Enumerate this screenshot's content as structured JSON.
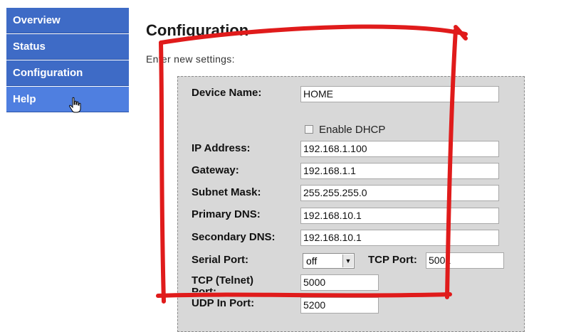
{
  "nav": {
    "items": [
      {
        "label": "Overview"
      },
      {
        "label": "Status"
      },
      {
        "label": "Configuration"
      },
      {
        "label": "Help"
      }
    ]
  },
  "page": {
    "title": "Configuration",
    "intro": "Enter new settings:"
  },
  "form": {
    "device_name": {
      "label": "Device Name:",
      "value": "HOME"
    },
    "dhcp": {
      "label": "Enable DHCP",
      "checked": false
    },
    "ip_address": {
      "label": "IP Address:",
      "value": "192.168.1.100"
    },
    "gateway": {
      "label": "Gateway:",
      "value": "192.168.1.1"
    },
    "subnet_mask": {
      "label": "Subnet Mask:",
      "value": "255.255.255.0"
    },
    "primary_dns": {
      "label": "Primary DNS:",
      "value": "192.168.10.1"
    },
    "secondary_dns": {
      "label": "Secondary DNS:",
      "value": "192.168.10.1"
    },
    "serial_port": {
      "label": "Serial Port:",
      "value": "off"
    },
    "tcp_port": {
      "label": "TCP Port:",
      "value": "5001"
    },
    "tcp_telnet_port": {
      "label": "TCP (Telnet) Port:",
      "value": "5000"
    },
    "udp_in_port": {
      "label": "UDP In Port:",
      "value": "5200"
    }
  },
  "annotation": {
    "color": "#e01b1b",
    "shape": "hand-drawn-rectangle"
  }
}
